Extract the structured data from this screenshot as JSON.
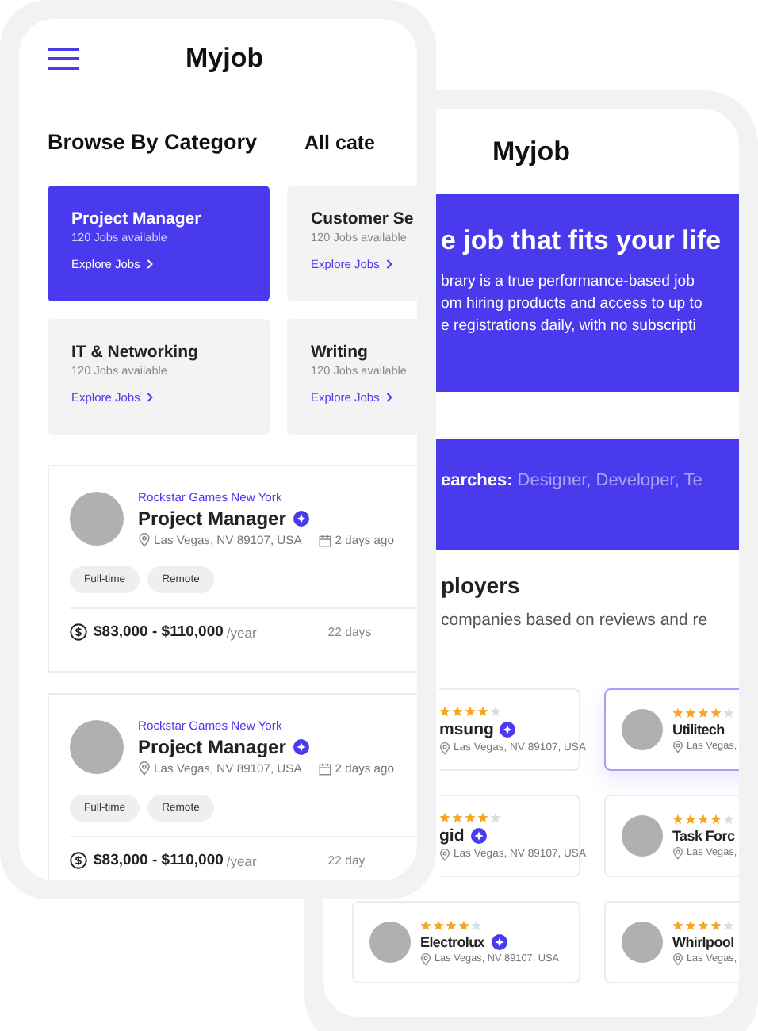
{
  "back": {
    "logo": "Myjob",
    "hero": {
      "title": "e job that fits your life",
      "lines": [
        "brary is a true performance-based job",
        "om hiring products and access to up to",
        "e registrations daily, with no subscripti"
      ]
    },
    "searches": {
      "label": "earches:",
      "terms": "Designer, Developer, Te"
    },
    "employers": {
      "title": "ployers",
      "subtitle": "companies based on reviews and re",
      "items": [
        {
          "kind": "partial",
          "name": "msung",
          "stars": 4,
          "verified": true,
          "location": "Las Vegas, NV 89107, USA",
          "selected": false
        },
        {
          "kind": "full",
          "name": "Utilitech",
          "stars": 4,
          "location": "Las Vegas,",
          "selected": true
        },
        {
          "kind": "partial",
          "name": "gid",
          "stars": 4,
          "verified": true,
          "location": "Las Vegas, NV 89107, USA",
          "selected": false
        },
        {
          "kind": "full",
          "name": "Task Forc",
          "stars": 4,
          "location": "Las Vegas,",
          "selected": false
        },
        {
          "kind": "full",
          "name": "Electrolux",
          "stars": 4,
          "verified": true,
          "location": "Las Vegas, NV 89107, USA",
          "selected": false
        },
        {
          "kind": "full",
          "name": "Whirlpool",
          "stars": 4,
          "location": "Las Vegas,",
          "selected": false
        }
      ]
    }
  },
  "front": {
    "logo": "Myjob",
    "section_title": "Browse By Category",
    "section_link": "All cate",
    "categories": [
      {
        "title": "Project Manager",
        "count": "120 Jobs available",
        "link": "Explore Jobs",
        "selected": true
      },
      {
        "title": "Customer Se",
        "count": "120 Jobs available",
        "link": "Explore Jobs",
        "selected": false
      },
      {
        "title": "IT & Networking",
        "count": "120 Jobs available",
        "link": "Explore Jobs",
        "selected": false
      },
      {
        "title": "Writing",
        "count": "120 Jobs available",
        "link": "Explore Jobs",
        "selected": false
      }
    ],
    "jobs": [
      {
        "company": "Rockstar Games New York",
        "title": "Project Manager",
        "verified": true,
        "location": "Las Vegas, NV 89107, USA",
        "posted": "2 days ago",
        "tags": [
          "Full-time",
          "Remote"
        ],
        "salary": "$83,000 - $110,000",
        "period": "/year",
        "age": "22 days"
      },
      {
        "company": "Rockstar Games New York",
        "title": "Project Manager",
        "verified": true,
        "location": "Las Vegas, NV 89107, USA",
        "posted": "2 days ago",
        "tags": [
          "Full-time",
          "Remote"
        ],
        "salary": "$83,000 - $110,000",
        "period": "/year",
        "age": "22 day"
      }
    ]
  }
}
